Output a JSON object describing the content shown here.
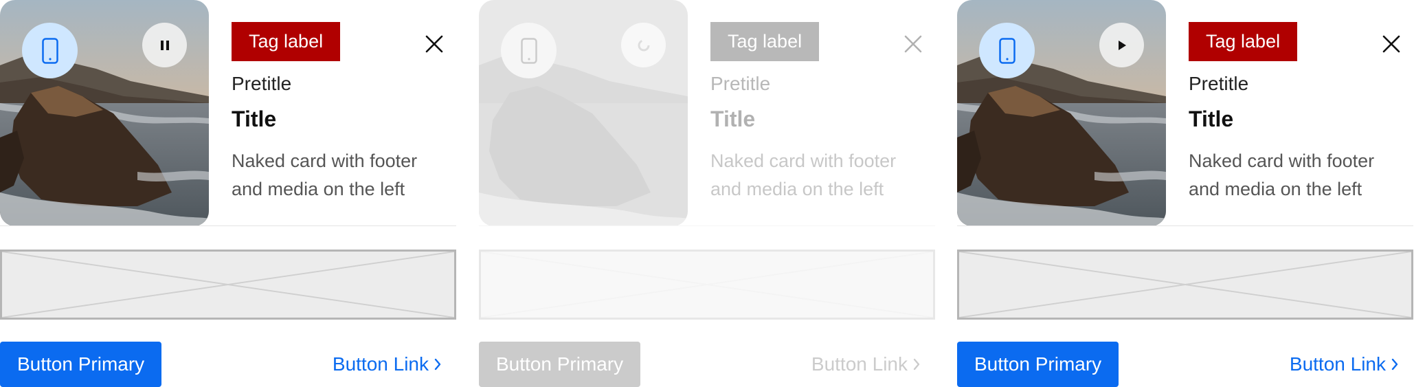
{
  "colors": {
    "brand_blue": "#0b6bf0",
    "tag_red": "#b00000",
    "device_circle": "#cfe7ff"
  },
  "cards": [
    {
      "state": "enabled",
      "media_controls": {
        "device_icon": "mobile-phone-icon",
        "playback_icon": "pause-icon"
      },
      "tag_label": "Tag label",
      "close_icon": "close-icon",
      "pretitle": "Pretitle",
      "title": "Title",
      "description": "Naked card with footer and media on the left",
      "slot_icon": "placeholder-cross-icon",
      "primary_button": "Button Primary",
      "link_button": "Button Link",
      "link_icon": "chevron-right-icon"
    },
    {
      "state": "disabled",
      "media_controls": {
        "device_icon": "mobile-phone-icon",
        "playback_icon": "loading-spinner-icon"
      },
      "tag_label": "Tag label",
      "close_icon": "close-icon",
      "pretitle": "Pretitle",
      "title": "Title",
      "description": "Naked card with footer and media on the left",
      "slot_icon": "placeholder-cross-icon",
      "primary_button": "Button Primary",
      "link_button": "Button Link",
      "link_icon": "chevron-right-icon"
    },
    {
      "state": "enabled",
      "media_controls": {
        "device_icon": "mobile-phone-icon",
        "playback_icon": "play-icon"
      },
      "tag_label": "Tag label",
      "close_icon": "close-icon",
      "pretitle": "Pretitle",
      "title": "Title",
      "description": "Naked card with footer and media on the left",
      "slot_icon": "placeholder-cross-icon",
      "primary_button": "Button Primary",
      "link_button": "Button Link",
      "link_icon": "chevron-right-icon"
    }
  ]
}
